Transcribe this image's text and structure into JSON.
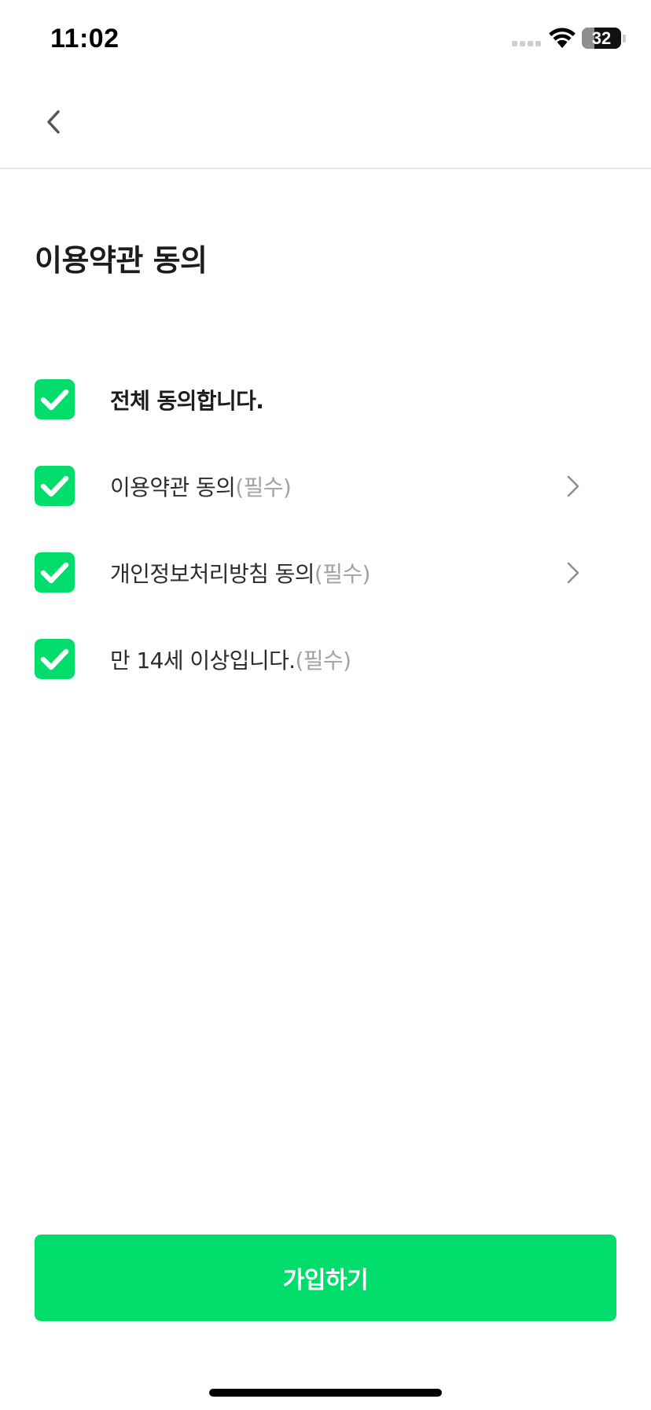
{
  "status_bar": {
    "time": "11:02",
    "battery_level": "32",
    "battery_fraction": 0.32,
    "icons": [
      "cellular-signal-icon",
      "wifi-icon",
      "battery-icon"
    ]
  },
  "nav": {
    "back_icon": "chevron-left-icon"
  },
  "title": "이용약관 동의",
  "agreements": [
    {
      "label": "전체 동의합니다.",
      "required_tag": "",
      "checked": true,
      "has_detail": false,
      "bold": true
    },
    {
      "label": "이용약관 동의",
      "required_tag": "(필수)",
      "checked": true,
      "has_detail": true,
      "bold": false
    },
    {
      "label": "개인정보처리방침 동의",
      "required_tag": "(필수)",
      "checked": true,
      "has_detail": true,
      "bold": false
    },
    {
      "label": "만 14세 이상입니다.",
      "required_tag": "(필수)",
      "checked": true,
      "has_detail": false,
      "bold": false
    }
  ],
  "signup_button_label": "가입하기",
  "colors": {
    "accent": "#00DD6B",
    "text_primary": "#1C1C1E",
    "text_secondary": "#A2A2A7",
    "divider": "#E5E5EA"
  }
}
